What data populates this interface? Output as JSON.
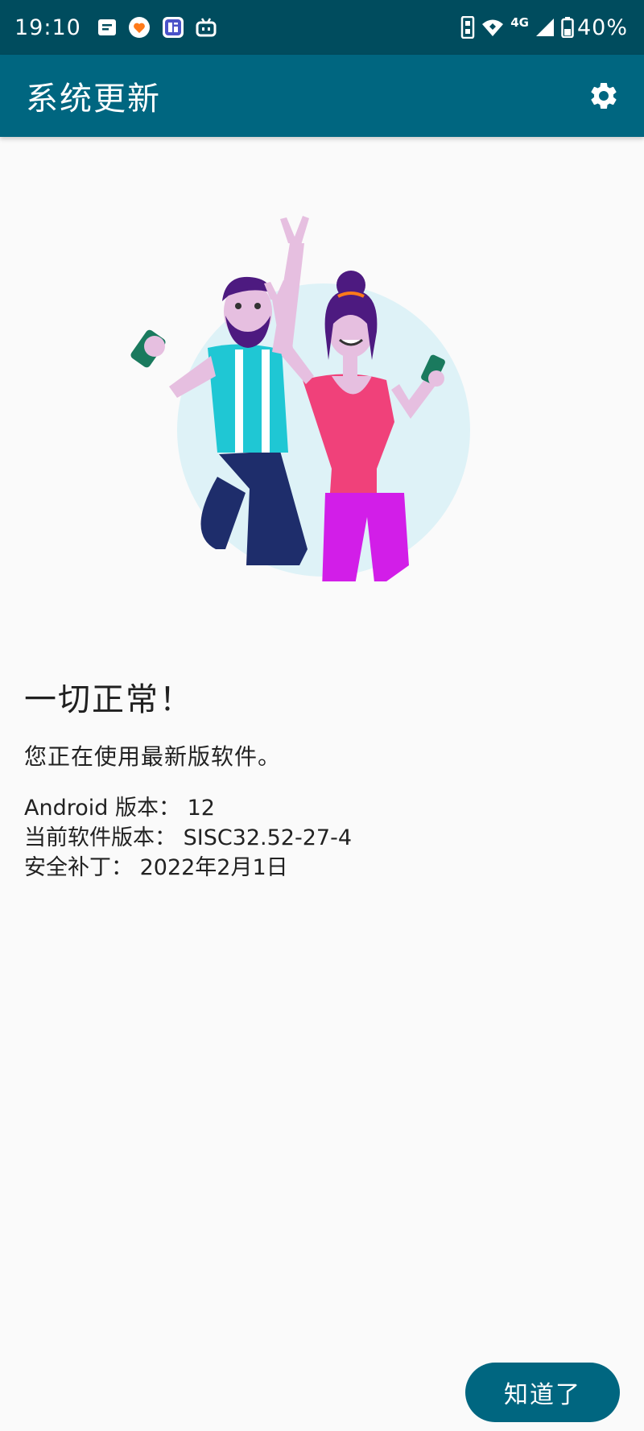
{
  "status_bar": {
    "time": "19:10",
    "network": "4G",
    "battery": "40%",
    "left_icons": [
      "message-icon",
      "heart-app-icon",
      "tieba-icon",
      "bilibili-icon"
    ],
    "right_icons": [
      "data-saver-icon",
      "wifi-icon",
      "signal-icon",
      "battery-icon"
    ]
  },
  "app_bar": {
    "title": "系统更新",
    "settings_icon": "gear-icon"
  },
  "main": {
    "heading": "一切正常！",
    "subtitle": "您正在使用最新版软件。",
    "info": [
      {
        "label": "Android 版本：",
        "value": "12"
      },
      {
        "label": "当前软件版本：",
        "value": "SISC32.52-27-4"
      },
      {
        "label": "安全补丁：",
        "value": "2022年2月1日"
      }
    ]
  },
  "actions": {
    "ok_label": "知道了"
  },
  "colors": {
    "status_bar": "#004c5e",
    "app_bar": "#006680",
    "button": "#006680",
    "background": "#fafafa",
    "circle": "#def2f7"
  }
}
